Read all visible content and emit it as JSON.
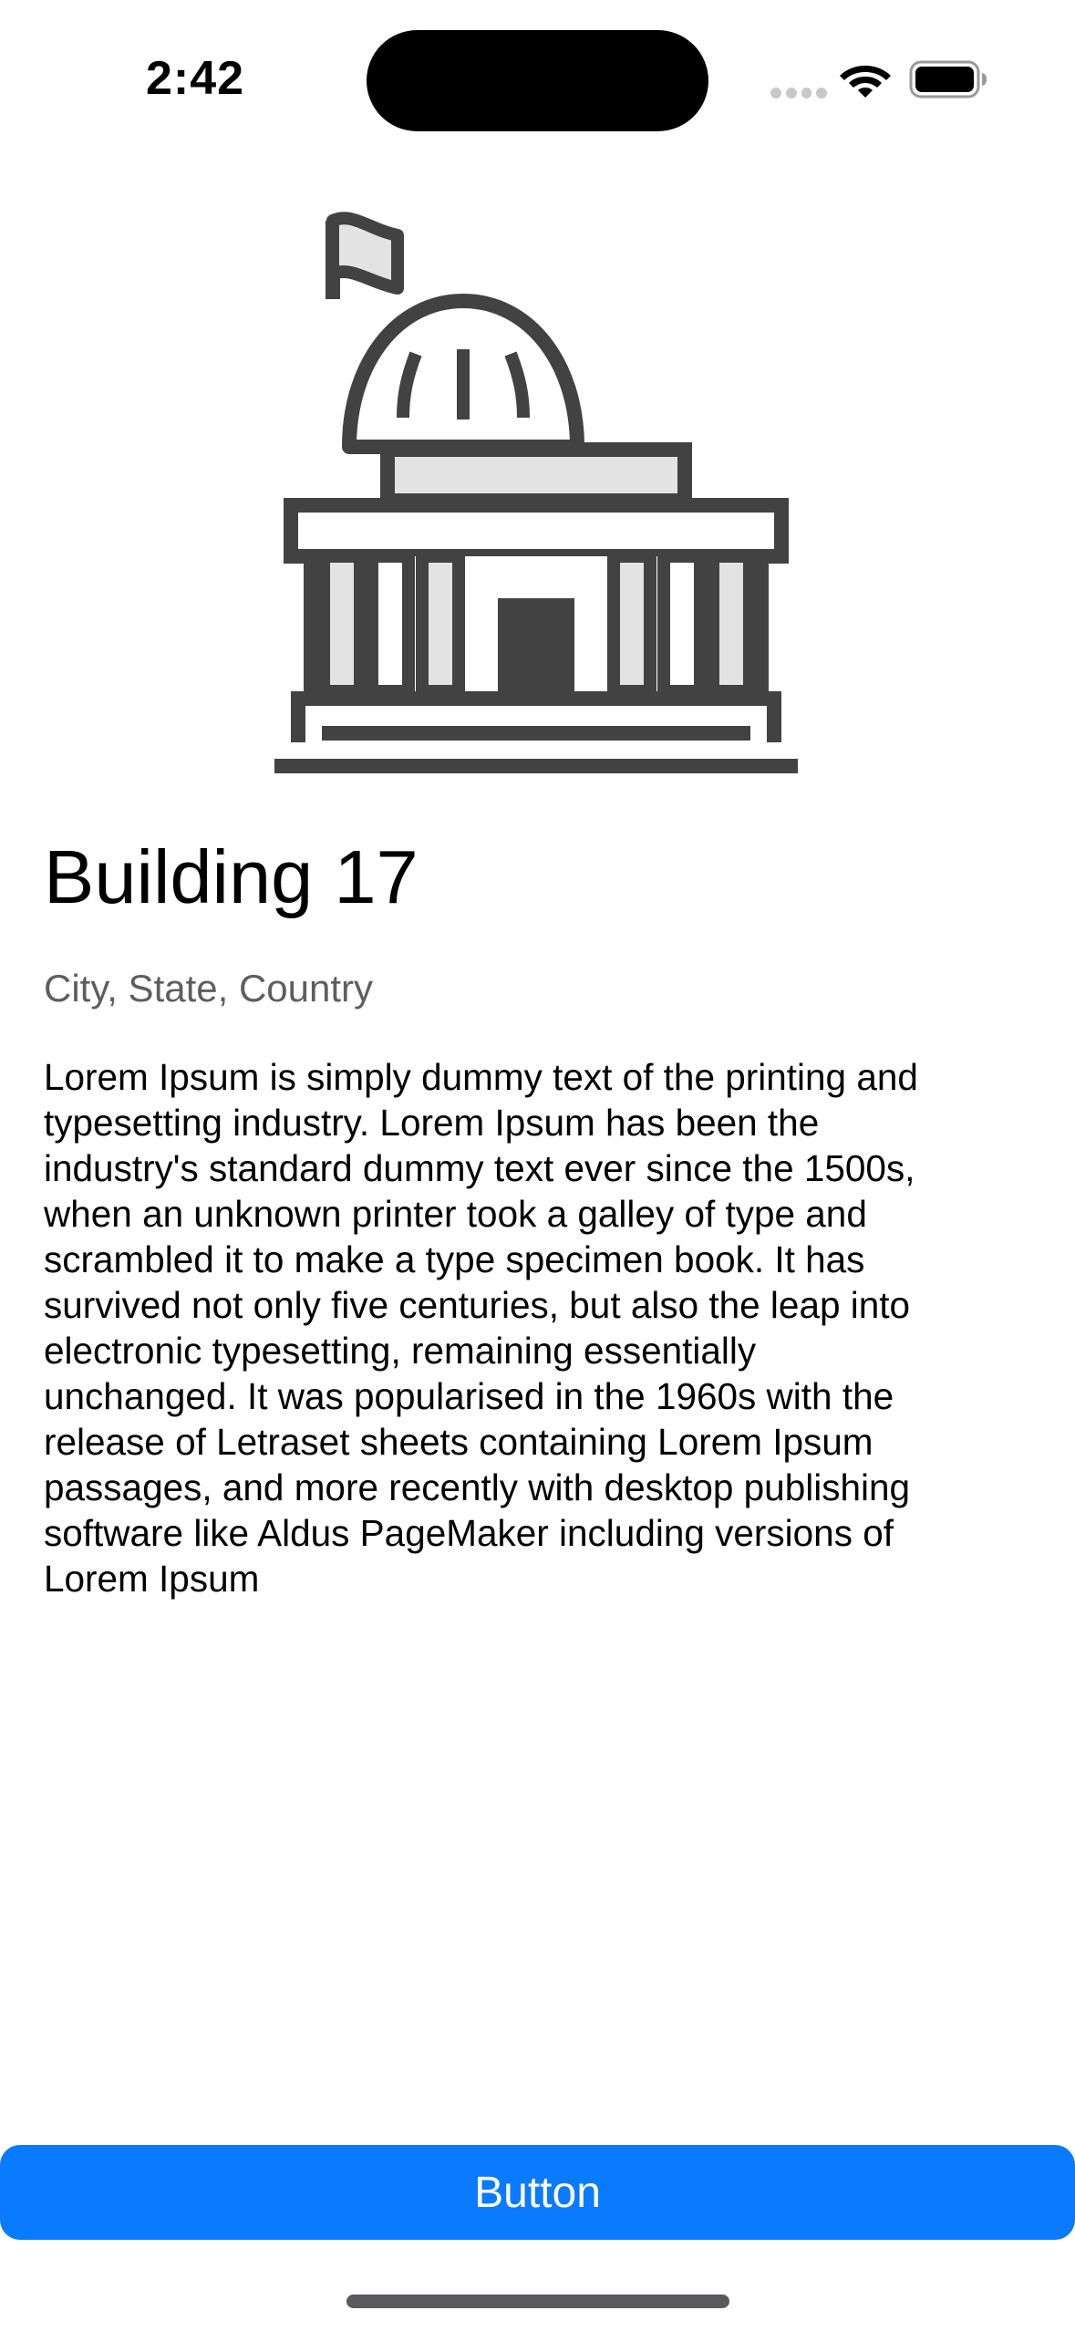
{
  "status_bar": {
    "time": "2:42",
    "icons": [
      "signal-icon",
      "wifi-icon",
      "battery-icon"
    ]
  },
  "hero": {
    "icon": "government-building-icon",
    "colors": {
      "stroke": "#424242",
      "fill": "#e3e3e3"
    }
  },
  "content": {
    "title": "Building 17",
    "subtitle": "City, State, Country",
    "body_lines": [
      "Lorem Ipsum is simply dummy text of the printing and",
      "typesetting industry. Lorem Ipsum has been the",
      "industry's standard dummy text ever since the 1500s,",
      "when an unknown printer took a galley of type and",
      "scrambled it to make a type specimen book. It has",
      "survived not only five centuries, but also the leap into",
      "electronic typesetting, remaining essentially",
      "unchanged. It was popularised in the 1960s with the",
      "release of Letraset sheets containing Lorem Ipsum",
      "passages, and more recently with desktop publishing",
      "software like Aldus PageMaker including versions of",
      "Lorem Ipsum"
    ]
  },
  "action": {
    "button_label": "Button",
    "color": "#0a7aff"
  }
}
